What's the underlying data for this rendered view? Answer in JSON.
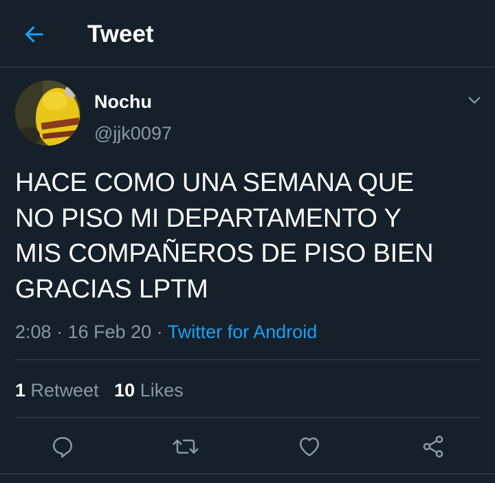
{
  "header": {
    "title": "Tweet",
    "back_icon": "arrow-left-icon"
  },
  "tweet": {
    "author": {
      "name": "Nochu",
      "handle": "@jjk0097"
    },
    "text_lines": [
      "HACE COMO UNA SEMANA QUE",
      "NO PISO MI DEPARTAMENTO Y",
      "MIS COMPAÑEROS DE PISO BIEN",
      "GRACIAS LPTM"
    ],
    "time": "2:08",
    "date": "16 Feb 20",
    "separator": "·",
    "source": "Twitter for Android",
    "stats": {
      "retweets_count": "1",
      "retweets_label": "Retweet",
      "likes_count": "10",
      "likes_label": "Likes"
    }
  },
  "actions": [
    "reply-icon",
    "retweet-icon",
    "like-icon",
    "share-icon"
  ],
  "colors": {
    "background": "#15202b",
    "accent": "#1da1f2",
    "secondary_text": "#8899a6",
    "divider": "#38444d"
  }
}
